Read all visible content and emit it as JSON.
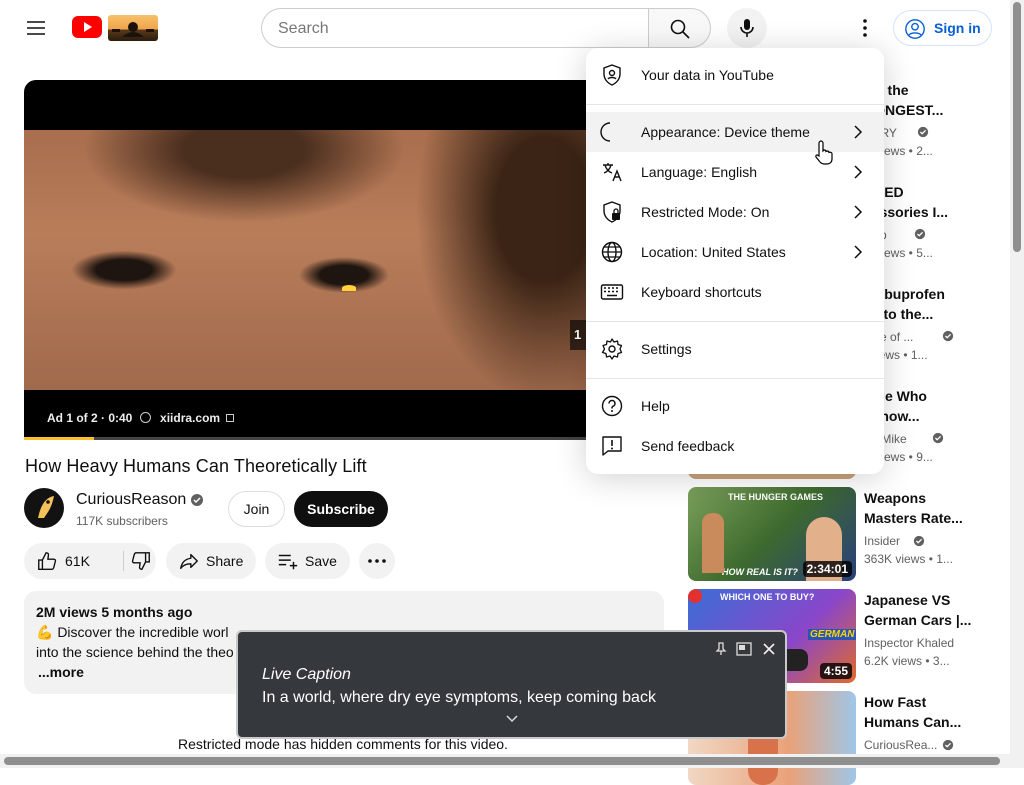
{
  "header": {
    "search_placeholder": "Search",
    "signin_label": "Sign in"
  },
  "player": {
    "ad_label": "Ad 1 of 2 · 0:40",
    "ad_domain": "xiidra.com",
    "ad_progress_fraction": 0.11,
    "skip_counter": "1"
  },
  "video": {
    "title": "How Heavy Humans Can Theoretically Lift",
    "channel_name": "CuriousReason",
    "subscribers": "117K subscribers",
    "join_label": "Join",
    "subscribe_label": "Subscribe",
    "like_count": "61K",
    "share_label": "Share",
    "save_label": "Save",
    "description_meta": "2M views  5 months ago",
    "description_line1": "💪 Discover the incredible worl",
    "description_line2": "into the science behind the theo",
    "description_more": "...more",
    "restricted_note": "Restricted mode has hidden comments for this video."
  },
  "menu": {
    "items": [
      {
        "label": "Your data in YouTube",
        "icon": "shield-person-icon"
      },
      {
        "label": "Appearance: Device theme",
        "icon": "moon-icon"
      },
      {
        "label": "Language: English",
        "icon": "translate-icon"
      },
      {
        "label": "Restricted Mode: On",
        "icon": "restricted-mode-icon"
      },
      {
        "label": "Location: United States",
        "icon": "globe-icon"
      },
      {
        "label": "Keyboard shortcuts",
        "icon": "keyboard-icon"
      },
      {
        "label": "Settings",
        "icon": "gear-icon"
      },
      {
        "label": "Help",
        "icon": "help-icon"
      },
      {
        "label": "Send feedback",
        "icon": "feedback-icon"
      }
    ]
  },
  "recommendations": [
    {
      "title1": "o's the",
      "title2": "RONGEST...",
      "channel": "TORY",
      "views": "K views  • 2..."
    },
    {
      "title1": "NNED",
      "title2": "cessories I...",
      "channel": "stop",
      "views": "K views  • 5..."
    },
    {
      "title1": "at Ibuprofen",
      "title2": "es to the...",
      "channel": "itute of ...",
      "views": "l views  • 1..."
    },
    {
      "title1": "ople Who",
      "title2": "nehow...",
      "channel": "tor Mike",
      "views": "K views  • 9..."
    },
    {
      "title1": "Weapons",
      "title2": "Masters Rate...",
      "channel": "Insider",
      "views": "363K views  • 1...",
      "duration": "2:34:01",
      "thumb_text": "THE HUNGER GAMES",
      "thumb_text2": "HOW REAL IS IT?"
    },
    {
      "title1": "Japanese VS",
      "title2": "German Cars |...",
      "channel": "Inspector Khaled",
      "views": "6.2K views  • 3...",
      "duration": "4:55",
      "thumb_text": "WHICH ONE TO BUY?",
      "thumb_text2": "GERMAN"
    },
    {
      "title1": "How Fast",
      "title2": "Humans Can...",
      "channel": "CuriousRea...",
      "views": ""
    }
  ],
  "live_caption": {
    "title": "Live Caption",
    "text": "In a world, where dry eye symptoms, keep coming back"
  },
  "colors": {
    "youtube_red": "#ff0000",
    "signin_blue": "#065fd4",
    "ad_progress": "#fbc02d",
    "caption_bg": "#35393d"
  }
}
